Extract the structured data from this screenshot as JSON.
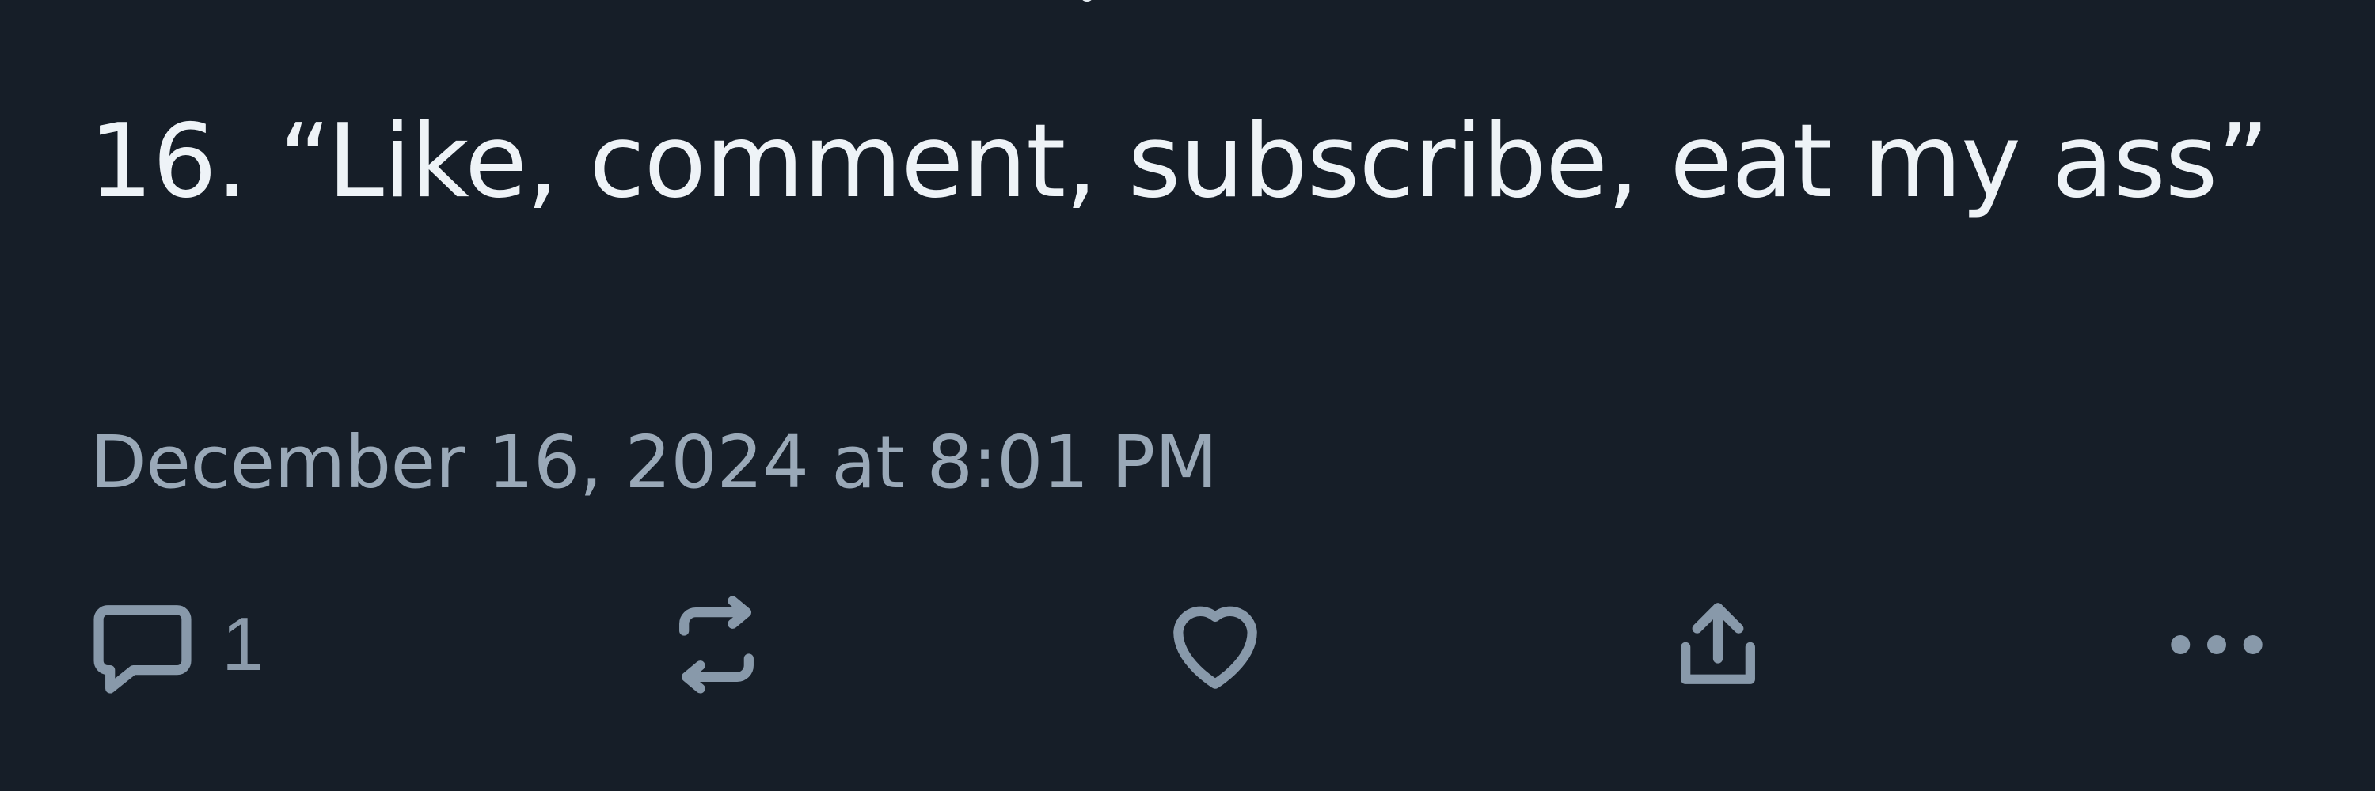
{
  "post": {
    "text": "16. “Like, comment, subscribe, eat my ass”",
    "timestamp": "December 16, 2024 at 8:01 PM"
  },
  "actions": {
    "reply_count": "1"
  },
  "icons": {
    "reply": "speech-bubble-icon",
    "repost": "repost-icon",
    "like": "heart-icon",
    "share": "share-icon",
    "more": "more-horizontal-icon"
  },
  "colors": {
    "background": "#161e28",
    "text": "#eef3f7",
    "muted": "#9aa9b8",
    "icon": "#8899aa"
  }
}
